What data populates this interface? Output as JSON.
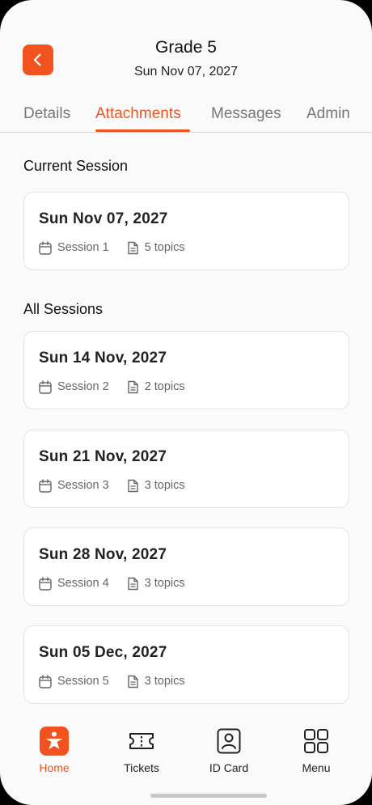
{
  "header": {
    "title": "Grade 5",
    "subtitle": "Sun Nov 07, 2027"
  },
  "tabs": [
    {
      "label": "Details",
      "active": false
    },
    {
      "label": "Attachments",
      "active": true
    },
    {
      "label": "Messages",
      "active": false
    },
    {
      "label": "Admin",
      "active": false
    }
  ],
  "current_section": {
    "title": "Current Session",
    "card": {
      "date": "Sun Nov 07, 2027",
      "session": "Session 1",
      "topics": "5 topics"
    }
  },
  "all_section": {
    "title": "All Sessions",
    "cards": [
      {
        "date": "Sun 14 Nov, 2027",
        "session": "Session 2",
        "topics": "2 topics"
      },
      {
        "date": "Sun 21 Nov, 2027",
        "session": "Session 3",
        "topics": "3 topics"
      },
      {
        "date": "Sun 28 Nov, 2027",
        "session": "Session 4",
        "topics": "3 topics"
      },
      {
        "date": "Sun 05 Dec, 2027",
        "session": "Session 5",
        "topics": "3 topics"
      }
    ]
  },
  "bottom_nav": [
    {
      "label": "Home",
      "icon": "home-person-icon",
      "active": true
    },
    {
      "label": "Tickets",
      "icon": "ticket-icon",
      "active": false
    },
    {
      "label": "ID Card",
      "icon": "id-card-icon",
      "active": false
    },
    {
      "label": "Menu",
      "icon": "grid-menu-icon",
      "active": false
    }
  ],
  "colors": {
    "accent": "#f2531e",
    "background": "#fafafa",
    "card": "#ffffff"
  }
}
